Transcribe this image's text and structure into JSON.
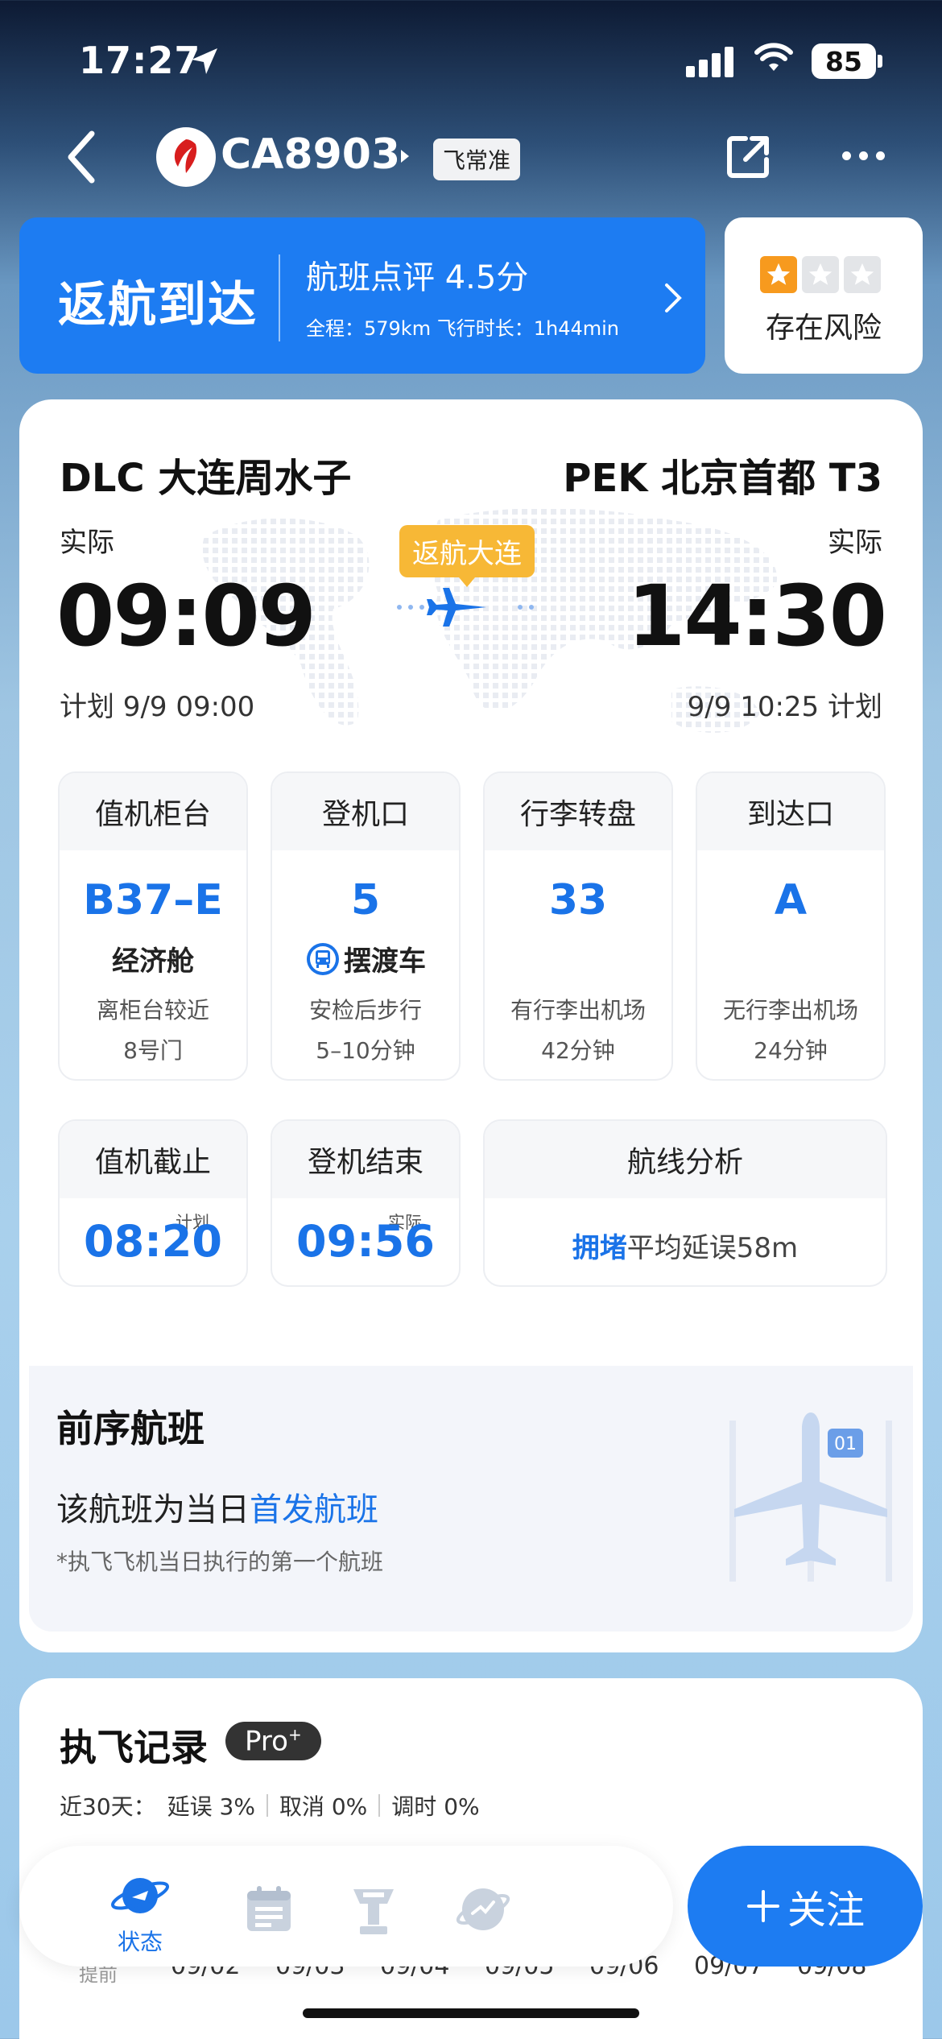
{
  "status_bar": {
    "time": "17:27",
    "battery": "85"
  },
  "nav": {
    "flight_no": "CA8903",
    "tag": "飞常准"
  },
  "banner": {
    "status": "返航到达",
    "rating": "航班点评 4.5分",
    "sub": "全程：579km  飞行时长：1h44min",
    "risk_label": "存在风险",
    "stars_filled": 1,
    "stars_total": 3
  },
  "route": {
    "dep_name": "DLC 大连周水子",
    "arr_name": "PEK 北京首都 T3",
    "dep_actual_label": "实际",
    "arr_actual_label": "实际",
    "dep_time": "09:09",
    "arr_time": "14:30",
    "dep_plan": "计划 9/9 09:00",
    "arr_plan": "9/9 10:25 计划",
    "return_tag": "返航大连"
  },
  "info": [
    {
      "head": "值机柜台",
      "value": "B37–E",
      "sub": "经济舱",
      "note1": "离柜台较近",
      "note2": "8号门"
    },
    {
      "head": "登机口",
      "value": "5",
      "sub": "摆渡车",
      "note1": "安检后步行",
      "note2": "5–10分钟"
    },
    {
      "head": "行李转盘",
      "value": "33",
      "sub": "",
      "note1": "有行李出机场",
      "note2": "42分钟"
    },
    {
      "head": "到达口",
      "value": "A",
      "sub": "",
      "note1": "无行李出机场",
      "note2": "24分钟"
    }
  ],
  "times": {
    "checkin_head": "值机截止",
    "checkin_tag": "计划",
    "checkin_val": "08:20",
    "board_head": "登机结束",
    "board_tag": "实际",
    "board_val": "09:56",
    "route_head": "航线分析",
    "route_status": "拥堵",
    "route_text": "平均延误58m"
  },
  "prev": {
    "title": "前序航班",
    "text": "该航班为当日",
    "highlight": "首发航班",
    "note": "*执飞飞机当日执行的第一个航班",
    "badge": "01"
  },
  "record": {
    "title": "执飞记录",
    "pro": "Pro",
    "range": "近30天：",
    "delay": "延误 3%",
    "cancel": "取消 0%",
    "adjust": "调时 0%",
    "y_label": "提前",
    "dates": [
      "09/02",
      "09/03",
      "09/04",
      "09/05",
      "09/06",
      "09/07",
      "09/08"
    ]
  },
  "tabbar": {
    "status_label": "状态",
    "follow": "关注"
  },
  "colors": {
    "accent": "#1d7cf2",
    "warning": "#f7b836",
    "link": "#1a73e8"
  }
}
